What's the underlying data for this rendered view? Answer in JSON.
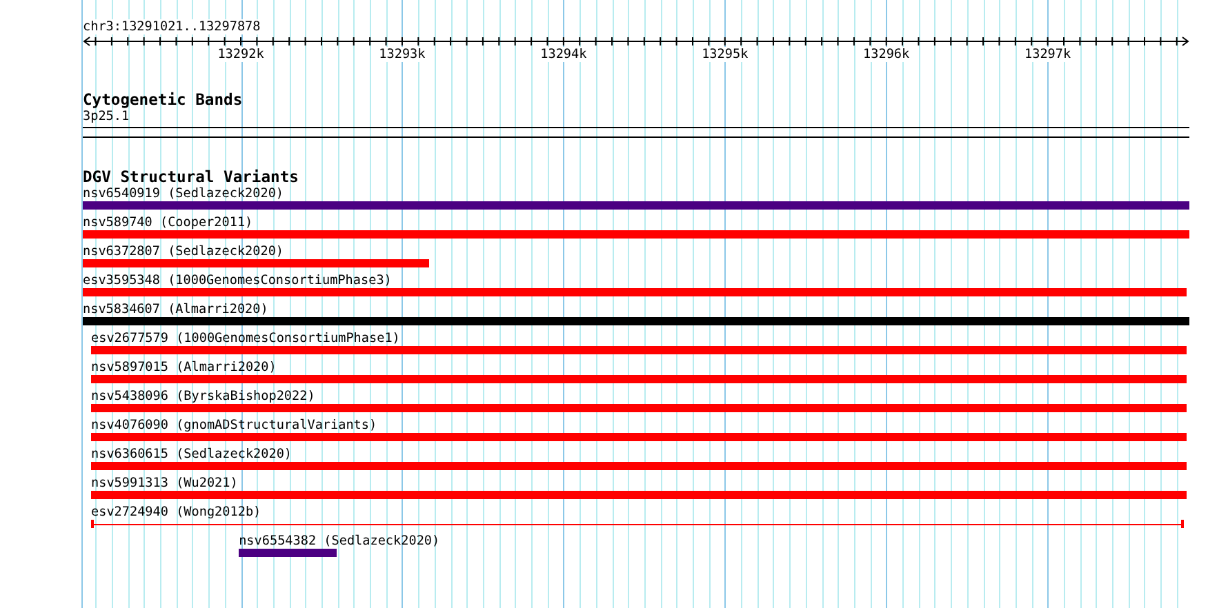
{
  "ruler": {
    "location": "chr3:13291021..13297878",
    "ticks": [
      "13292k",
      "13293k",
      "13294k",
      "13295k",
      "13296k",
      "13297k"
    ]
  },
  "cytoband_track": {
    "title": "Cytogenetic Bands",
    "band": "3p25.1"
  },
  "dgv_track": {
    "title": "DGV Structural Variants",
    "features": [
      {
        "label": "nsv6540919 (Sedlazeck2020)",
        "kind": "bar",
        "color": "#4b0082"
      },
      {
        "label": "nsv589740 (Cooper2011)",
        "kind": "bar",
        "color": "#ff0000"
      },
      {
        "label": "nsv6372807 (Sedlazeck2020)",
        "kind": "bar",
        "color": "#ff0000"
      },
      {
        "label": "esv3595348 (1000GenomesConsortiumPhase3)",
        "kind": "bar",
        "color": "#ff0000"
      },
      {
        "label": "nsv5834607 (Almarri2020)",
        "kind": "bar",
        "color": "#000000"
      },
      {
        "label": "esv2677579 (1000GenomesConsortiumPhase1)",
        "kind": "bar",
        "color": "#ff0000"
      },
      {
        "label": "nsv5897015 (Almarri2020)",
        "kind": "bar",
        "color": "#ff0000"
      },
      {
        "label": "nsv5438096 (ByrskaBishop2022)",
        "kind": "bar",
        "color": "#ff0000"
      },
      {
        "label": "nsv4076090 (gnomADStructuralVariants)",
        "kind": "bar",
        "color": "#ff0000"
      },
      {
        "label": "nsv6360615 (Sedlazeck2020)",
        "kind": "bar",
        "color": "#ff0000"
      },
      {
        "label": "nsv5991313 (Wu2021)",
        "kind": "bar",
        "color": "#ff0000"
      },
      {
        "label": "esv2724940 (Wong2012b)",
        "kind": "line",
        "color": "#ff0000"
      },
      {
        "label": "nsv6554382 (Sedlazeck2020)",
        "kind": "bar",
        "color": "#4b0082"
      }
    ]
  }
}
